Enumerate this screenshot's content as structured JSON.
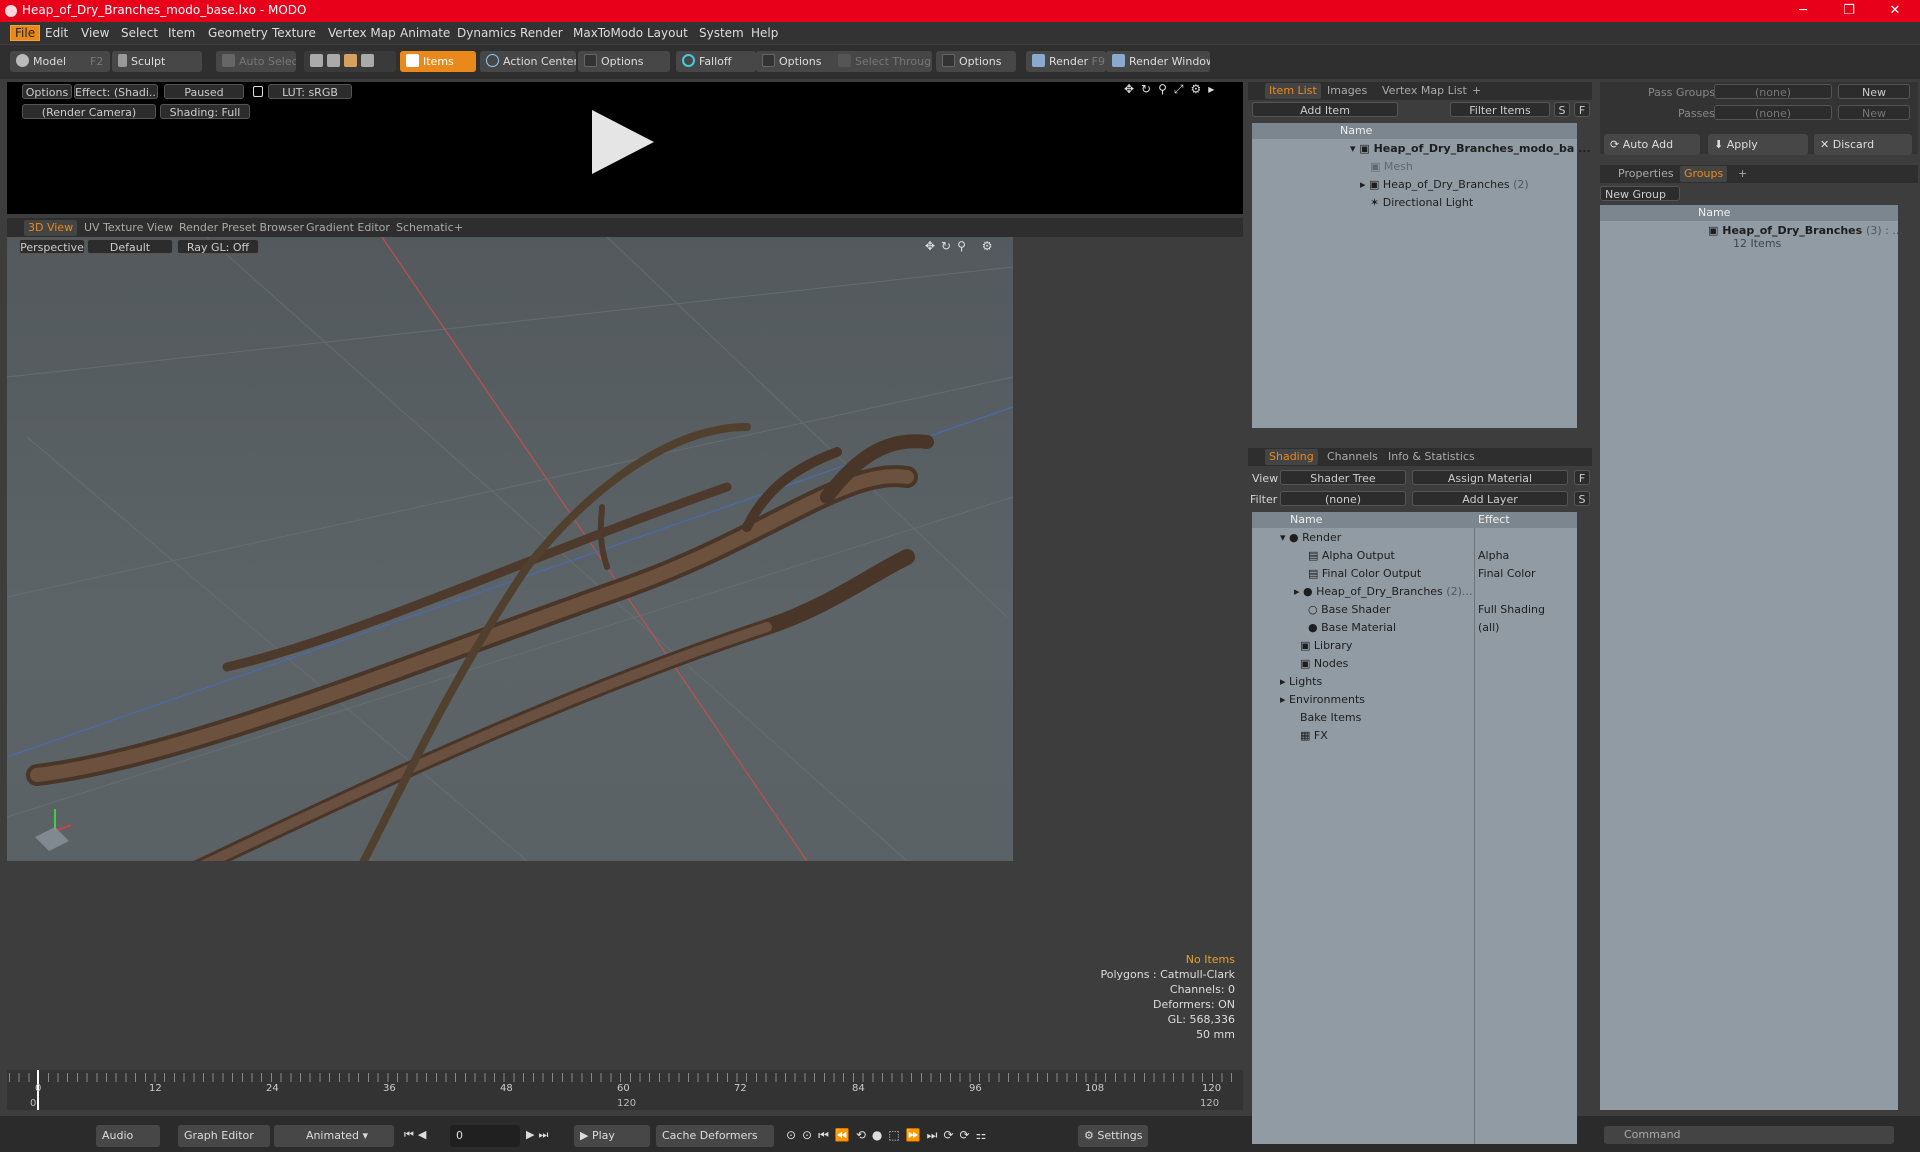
{
  "window": {
    "title": "Heap_of_Dry_Branches_modo_base.lxo - MODO",
    "min": "─",
    "max": "❐",
    "close": "✕"
  },
  "menu": [
    "File",
    "Edit",
    "View",
    "Select",
    "Item",
    "Geometry",
    "Texture",
    "Vertex Map",
    "Animate",
    "Dynamics",
    "Render",
    "MaxToModo",
    "Layout",
    "System",
    "Help"
  ],
  "toolbar": {
    "model": "Model",
    "model_key": "F2",
    "sculpt": "Sculpt",
    "auto_select": "Auto Select",
    "items": "Items",
    "action_center": "Action Center",
    "options1": "Options",
    "falloff": "Falloff",
    "options2": "Options",
    "select_through": "Select Through",
    "options3": "Options",
    "render": "Render",
    "render_key": "F9",
    "render_window": "Render Window"
  },
  "preview": {
    "options": "Options",
    "effect": "Effect: (Shadi...",
    "paused": "Paused",
    "lut": "LUT: sRGB",
    "camera": "(Render Camera)",
    "shading": "Shading: Full"
  },
  "viewtabs": [
    "3D View",
    "UV Texture View",
    "Render Preset Browser",
    "Gradient Editor",
    "Schematic"
  ],
  "viewport": {
    "perspective": "Perspective",
    "default": "Default",
    "raygl": "Ray GL: Off"
  },
  "stats": {
    "no_items": "No Items",
    "polygons": "Polygons : Catmull-Clark",
    "channels": "Channels: 0",
    "deformers": "Deformers: ON",
    "gl": "GL: 568,336",
    "mm": "50 mm"
  },
  "timeline": {
    "ticks": [
      "0",
      "12",
      "24",
      "36",
      "48",
      "60",
      "72",
      "84",
      "96",
      "108",
      "120"
    ],
    "start": "0",
    "mid": "120",
    "end": "120"
  },
  "bottom": {
    "audio": "Audio",
    "graph": "Graph Editor",
    "animated": "Animated",
    "frame": "0",
    "play": "Play",
    "cache": "Cache Deformers",
    "settings": "Settings"
  },
  "itemlist": {
    "tabs": [
      "Item List",
      "Images",
      "Vertex Map List"
    ],
    "add_item": "Add Item",
    "filter": "Filter Items",
    "s": "S",
    "f": "F",
    "col_name": "Name",
    "rows": [
      {
        "label": "Heap_of_Dry_Branches_modo_ba ...",
        "bold": true
      },
      {
        "label": "Mesh",
        "dim": true
      },
      {
        "label": "Heap_of_Dry_Branches",
        "count": "(2)"
      },
      {
        "label": "Directional Light"
      }
    ]
  },
  "shading": {
    "tabs": [
      "Shading",
      "Channels",
      "Info & Statistics"
    ],
    "view_label": "View",
    "view_val": "Shader Tree",
    "assign": "Assign Material",
    "filter_label": "Filter",
    "filter_val": "(none)",
    "add_layer": "Add Layer",
    "f": "F",
    "s": "S",
    "col_name": "Name",
    "col_effect": "Effect",
    "rows": [
      {
        "label": "Render",
        "effect": ""
      },
      {
        "label": "Alpha Output",
        "effect": "Alpha"
      },
      {
        "label": "Final Color Output",
        "effect": "Final Color"
      },
      {
        "label": "Heap_of_Dry_Branches",
        "count": "(2)...",
        "effect": ""
      },
      {
        "label": "Base Shader",
        "effect": "Full Shading"
      },
      {
        "label": "Base Material",
        "effect": "(all)"
      },
      {
        "label": "Library",
        "effect": ""
      },
      {
        "label": "Nodes",
        "effect": ""
      },
      {
        "label": "Lights",
        "effect": ""
      },
      {
        "label": "Environments",
        "effect": ""
      },
      {
        "label": "Bake Items",
        "effect": ""
      },
      {
        "label": "FX",
        "effect": ""
      }
    ]
  },
  "right": {
    "pass_groups": "Pass Groups",
    "passes": "Passes",
    "none1": "(none)",
    "none2": "(none)",
    "new1": "New",
    "new2": "New",
    "auto_add": "Auto Add",
    "apply": "Apply",
    "discard": "Discard",
    "tabs": [
      "Properties",
      "Groups"
    ],
    "new_group": "New Group",
    "col_name": "Name",
    "group_name": "Heap_of_Dry_Branches",
    "group_count": "(3) : ...",
    "group_items": "12 Items",
    "command": "Command"
  },
  "colors": {
    "accent": "#e8891a",
    "titlebar": "#e8001a"
  }
}
